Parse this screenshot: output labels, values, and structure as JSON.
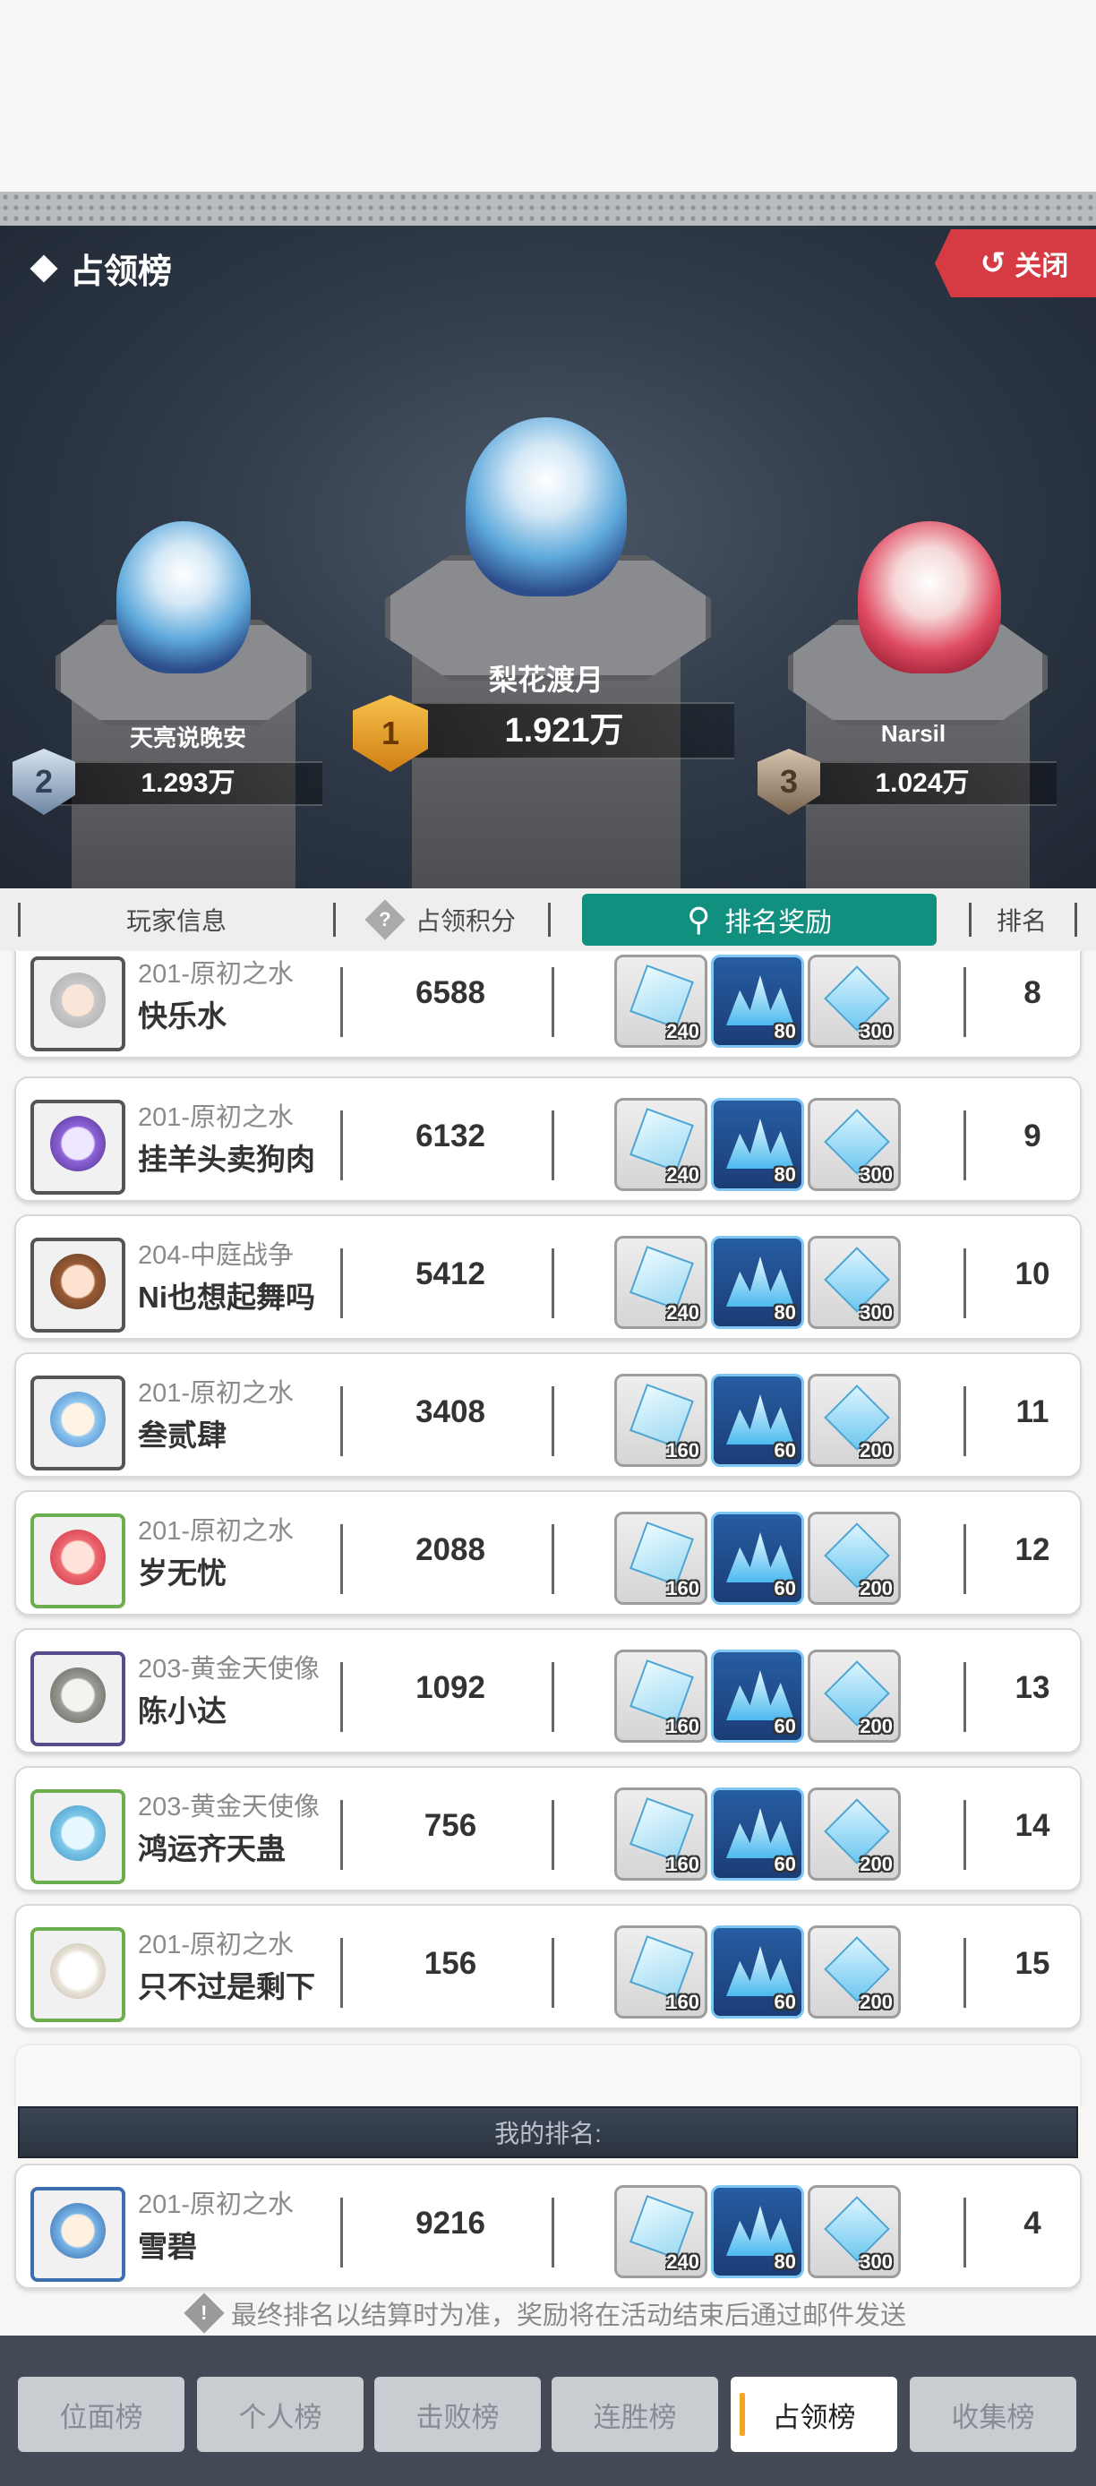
{
  "header": {
    "title": "占领榜",
    "close_label": "关闭"
  },
  "podium": {
    "first": {
      "rank": "1",
      "name": "梨花渡月",
      "score": "1.921万"
    },
    "second": {
      "rank": "2",
      "name": "天亮说晚安",
      "score": "1.293万"
    },
    "third": {
      "rank": "3",
      "name": "Narsil",
      "score": "1.024万"
    }
  },
  "columns": {
    "player_info": "玩家信息",
    "score": "占领积分",
    "reward": "排名奖励",
    "rank": "排名"
  },
  "rows": [
    {
      "server": "201-原初之水",
      "name": "快乐水",
      "score": "6588",
      "rank": "8",
      "rewards": [
        "240",
        "80",
        "300"
      ]
    },
    {
      "server": "201-原初之水",
      "name": "挂羊头卖狗肉",
      "score": "6132",
      "rank": "9",
      "rewards": [
        "240",
        "80",
        "300"
      ]
    },
    {
      "server": "204-中庭战争",
      "name": "Ni也想起舞吗",
      "score": "5412",
      "rank": "10",
      "rewards": [
        "240",
        "80",
        "300"
      ]
    },
    {
      "server": "201-原初之水",
      "name": "叁贰肆",
      "score": "3408",
      "rank": "11",
      "rewards": [
        "160",
        "60",
        "200"
      ]
    },
    {
      "server": "201-原初之水",
      "name": "岁无忧",
      "score": "2088",
      "rank": "12",
      "rewards": [
        "160",
        "60",
        "200"
      ]
    },
    {
      "server": "203-黄金天使像",
      "name": "陈小达",
      "score": "1092",
      "rank": "13",
      "rewards": [
        "160",
        "60",
        "200"
      ]
    },
    {
      "server": "203-黄金天使像",
      "name": "鸿运齐天蛊",
      "score": "756",
      "rank": "14",
      "rewards": [
        "160",
        "60",
        "200"
      ]
    },
    {
      "server": "201-原初之水",
      "name": "只不过是剩下",
      "score": "156",
      "rank": "15",
      "rewards": [
        "160",
        "60",
        "200"
      ]
    }
  ],
  "my_rank": {
    "label": "我的排名:",
    "server": "201-原初之水",
    "name": "雪碧",
    "score": "9216",
    "rank": "4",
    "rewards": [
      "240",
      "80",
      "300"
    ]
  },
  "footer_note": "最终排名以结算时为准，奖励将在活动结束后通过邮件发送",
  "bottom_tabs": [
    "位面榜",
    "个人榜",
    "击败榜",
    "连胜榜",
    "占领榜",
    "收集榜"
  ],
  "active_tab": "占领榜"
}
